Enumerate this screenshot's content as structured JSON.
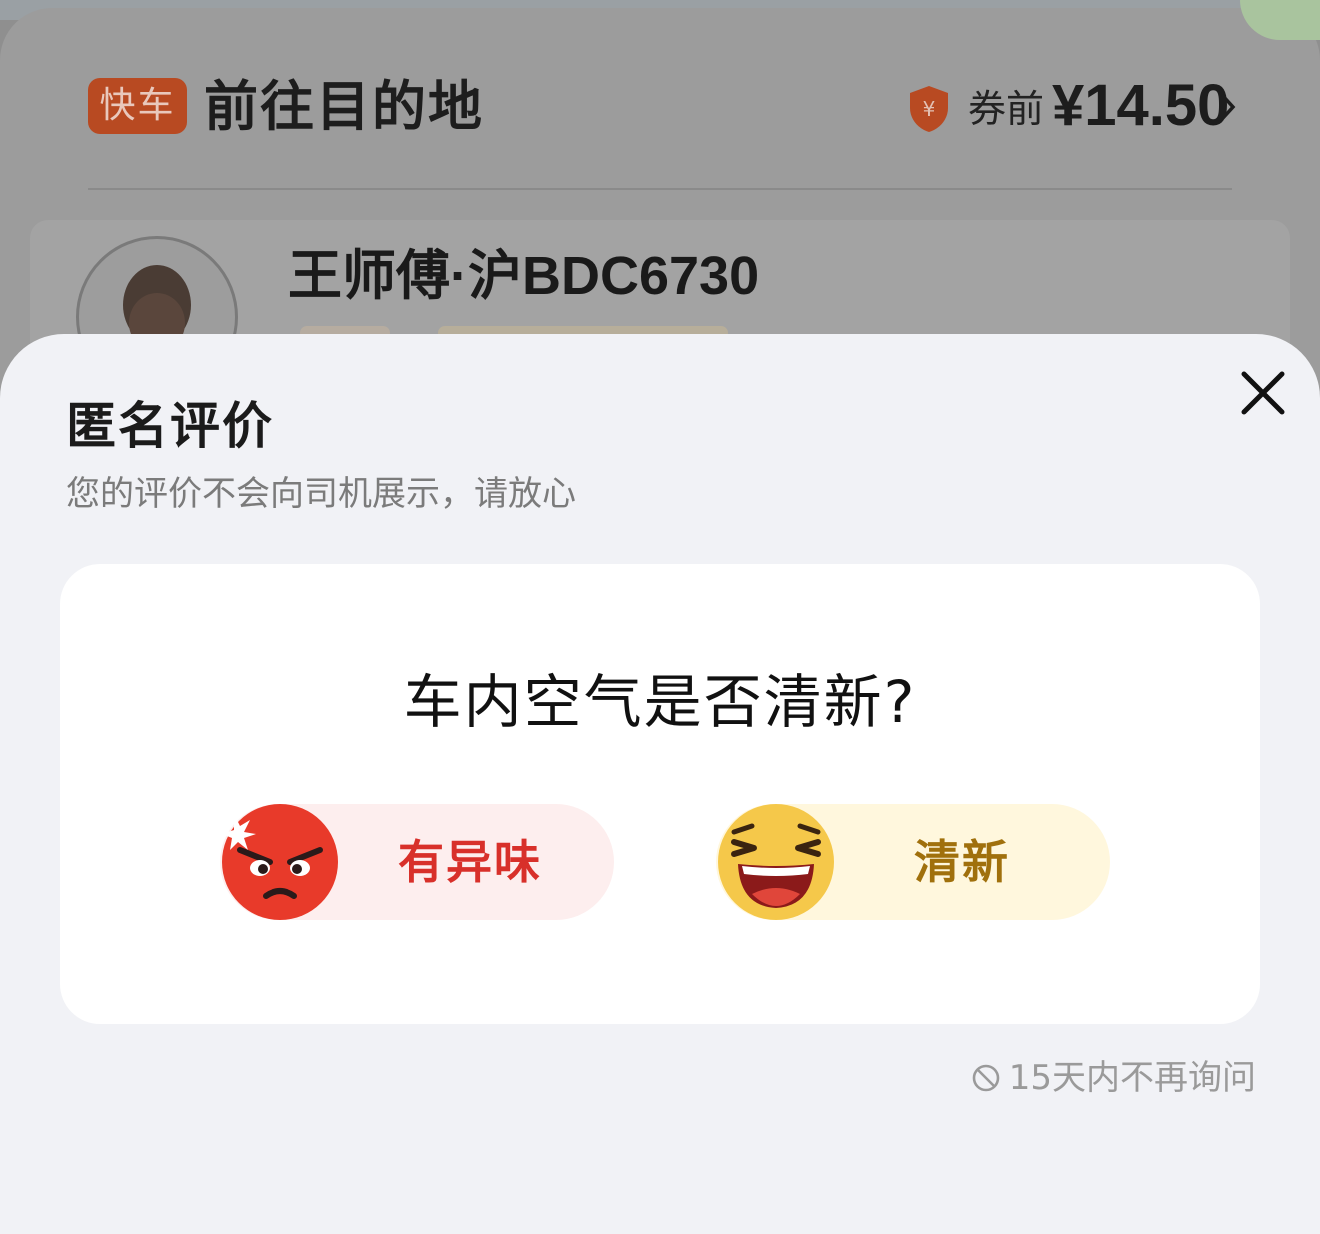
{
  "trip": {
    "tag": "快车",
    "title": "前往目的地",
    "price_prefix": "券前",
    "price": "¥14.50",
    "driver": "王师傅·沪BDC6730"
  },
  "sheet": {
    "title": "匿名评价",
    "subtitle": "您的评价不会向司机展示，请放心",
    "question": "车内空气是否清新?",
    "options": [
      {
        "label": "有异味",
        "icon": "angry-face-icon"
      },
      {
        "label": "清新",
        "icon": "laughing-face-icon"
      }
    ],
    "no_ask": "15天内不再询问"
  },
  "colors": {
    "bad_accent": "#d8302a",
    "good_accent": "#a0700c",
    "tag_bg": "#b84a22"
  }
}
